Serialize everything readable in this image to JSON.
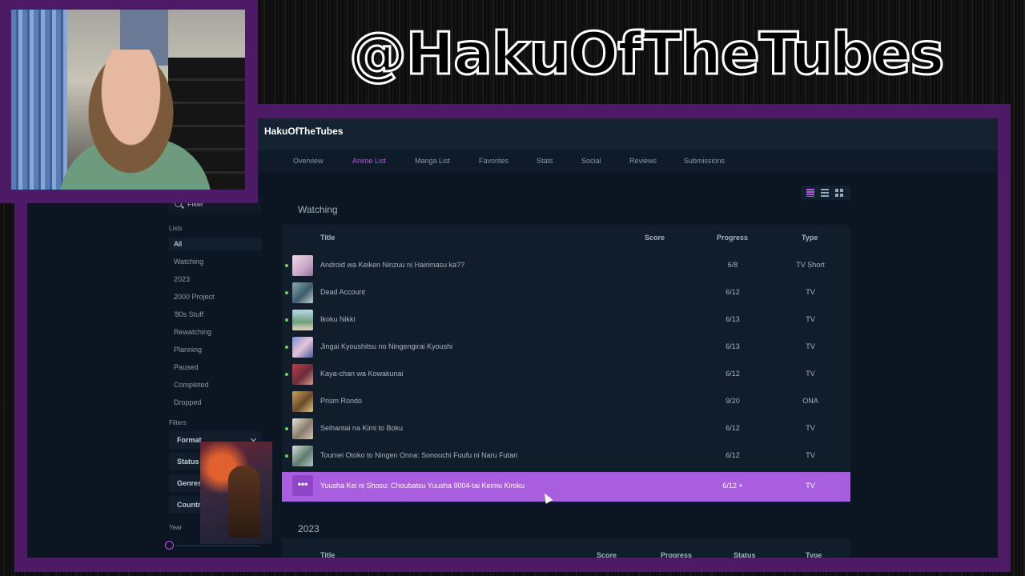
{
  "streamer_handle": "@HakuOfTheTubes",
  "profile": {
    "username": "HakuOfTheTubes"
  },
  "nav": {
    "tabs": [
      {
        "label": "Overview"
      },
      {
        "label": "Anime List"
      },
      {
        "label": "Manga List"
      },
      {
        "label": "Favorites"
      },
      {
        "label": "Stats"
      },
      {
        "label": "Social"
      },
      {
        "label": "Reviews"
      },
      {
        "label": "Submissions"
      }
    ],
    "active": "Anime List"
  },
  "sidebar": {
    "filter_placeholder": "Filter",
    "lists_heading": "Lists",
    "lists": [
      "All",
      "Watching",
      "2023",
      "2000 Project",
      "'80s Stuff",
      "Rewatching",
      "Planning",
      "Paused",
      "Completed",
      "Dropped"
    ],
    "filters_heading": "Filters",
    "filters": [
      "Format",
      "Status",
      "Genres",
      "Country"
    ],
    "year_label": "Year"
  },
  "colors": {
    "accent": "#c054e6",
    "highlight_row": "#a95ee0",
    "watching_dot": "#6bd157"
  },
  "sections": [
    {
      "title": "Watching",
      "columns": {
        "title": "Title",
        "score": "Score",
        "progress": "Progress",
        "type": "Type"
      },
      "rows": [
        {
          "title": "Android wa Keiken Ninzuu ni Hairimasu ka??",
          "progress": "6/8",
          "type": "TV Short"
        },
        {
          "title": "Dead Account",
          "progress": "6/12",
          "type": "TV"
        },
        {
          "title": "Ikoku Nikki",
          "progress": "6/13",
          "type": "TV"
        },
        {
          "title": "Jingai Kyoushitsu no Ningengirai Kyoushi",
          "progress": "6/13",
          "type": "TV"
        },
        {
          "title": "Kaya-chan wa Kowakunai",
          "progress": "6/12",
          "type": "TV"
        },
        {
          "title": "Prism Rondo",
          "progress": "9/20",
          "type": "ONA"
        },
        {
          "title": "Seihantai na Kimi to Boku",
          "progress": "6/12",
          "type": "TV"
        },
        {
          "title": "Toumei Otoko to Ningen Onna: Sonouchi Fuufu ni Naru Futari",
          "progress": "6/12",
          "type": "TV"
        },
        {
          "title": "Yuusha Kei ni Shosu: Choubatsu Yuusha 9004-tai Keimu Kiroku",
          "progress": "6/12 +",
          "type": "TV",
          "more_label": "•••"
        }
      ]
    },
    {
      "title": "2023",
      "columns": {
        "title": "Title",
        "score": "Score",
        "progress": "Progress",
        "status": "Status",
        "type": "Type"
      }
    }
  ]
}
